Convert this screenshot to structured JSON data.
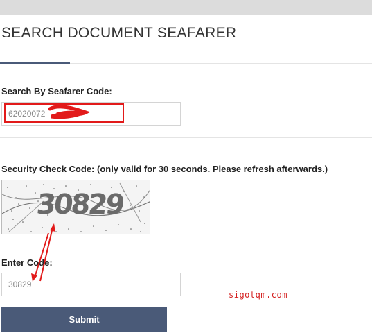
{
  "header": {
    "title": "SEARCH DOCUMENT SEAFARER"
  },
  "seafarer_search": {
    "label": "Search By Seafarer Code:",
    "value": "62020072"
  },
  "security": {
    "label": "Security Check Code: (only valid for 30 seconds. Please refresh afterwards.)",
    "captcha_text": "30829"
  },
  "enter_code": {
    "label": "Enter Code:",
    "value": "30829"
  },
  "submit": {
    "label": "Submit"
  },
  "watermark": {
    "text": "sigotqm.com"
  },
  "colors": {
    "accent": "#4a5a78",
    "annotation_red": "#e21a1a",
    "topbar": "#dcdcdc"
  }
}
